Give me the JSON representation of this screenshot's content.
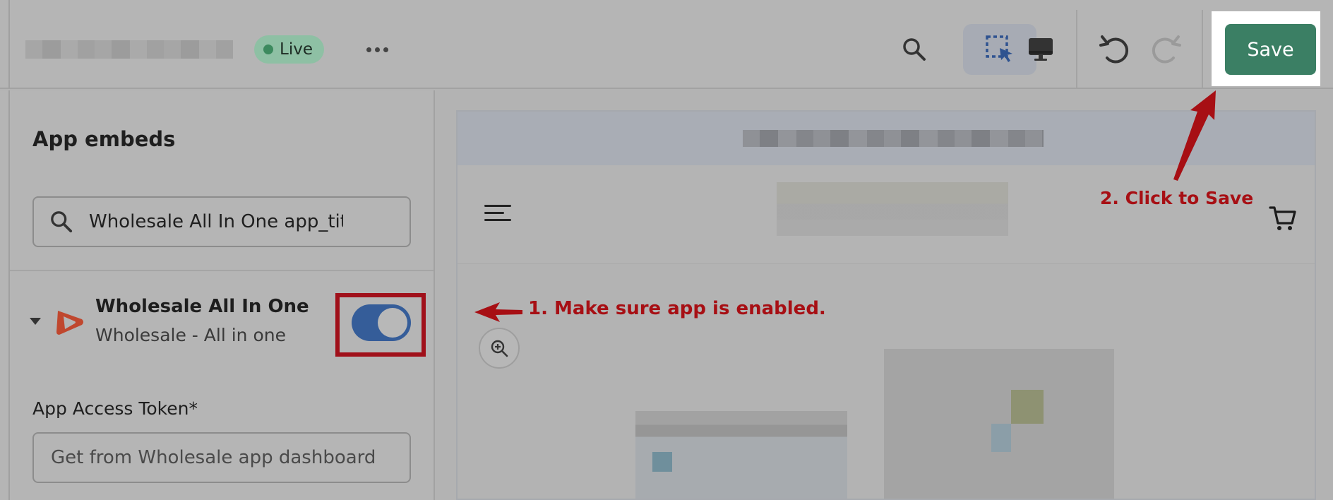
{
  "topbar": {
    "status_badge": "Live",
    "more_icon": "ellipsis-icon",
    "icons": [
      "search-icon",
      "select-cursor-icon",
      "desktop-icon",
      "undo-icon",
      "redo-icon"
    ],
    "save_label": "Save"
  },
  "sidebar": {
    "section_title": "App embeds",
    "search": {
      "value": "Wholesale All In One app_tit"
    },
    "app": {
      "name": "Wholesale All In One",
      "subtitle": "Wholesale - All in one",
      "enabled": true
    },
    "token_field": {
      "label": "App Access Token*",
      "placeholder": "Get from Wholesale app dashboard"
    }
  },
  "annotations": {
    "step1": "1. Make sure app is enabled.",
    "step2": "2. Click to Save",
    "color": "#a70f14"
  },
  "colors": {
    "save_button": "#3b7f64",
    "toggle_on": "#355d99",
    "live_badge": "#8ec0a4"
  }
}
